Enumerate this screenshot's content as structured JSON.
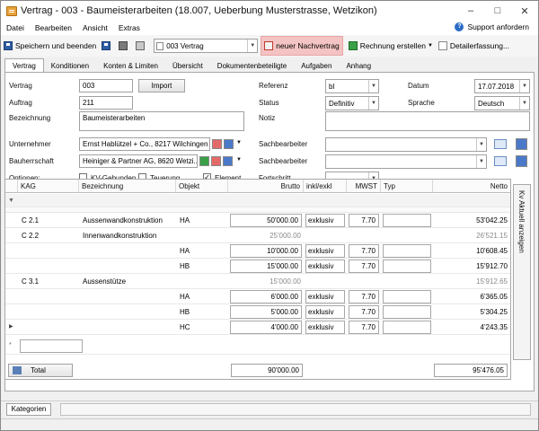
{
  "window": {
    "title": "Vertrag - 003 - Baumeisterarbeiten (18.007, Ueberbung Musterstrasse, Wetzikon)"
  },
  "menu": [
    "Datei",
    "Bearbeiten",
    "Ansicht",
    "Extras"
  ],
  "support": "Support anfordern",
  "toolbar": {
    "save_close": "Speichern und beenden",
    "vertrag_select": "003 Vertrag",
    "nachtrag": "neuer Nachvertrag",
    "rechnung": "Rechnung erstellen",
    "detail": "Detailerfassung..."
  },
  "tabs": [
    "Vertrag",
    "Konditionen",
    "Konten & Limiten",
    "Übersicht",
    "Dokumentenbeteiligte",
    "Aufgaben",
    "Anhang"
  ],
  "form": {
    "vertrag_label": "Vertrag",
    "vertrag_value": "003",
    "import_btn": "Import",
    "auftrag_label": "Auftrag",
    "auftrag_value": "211",
    "bezeichnung_label": "Bezeichnung",
    "bezeichnung_value": "Baumeisterarbeiten",
    "referenz_label": "Referenz",
    "referenz_value": "bl",
    "status_label": "Status",
    "status_value": "Definitiv",
    "notiz_label": "Notiz",
    "datum_label": "Datum",
    "datum_value": "17.07.2018",
    "sprache_label": "Sprache",
    "sprache_value": "Deutsch",
    "unternehmer_label": "Unternehmer",
    "unternehmer_value": "Ernst Hablützel + Co., 8217 Wilchingen",
    "bauherr_label": "Bauherrschaft",
    "bauherr_value": "Heiniger & Partner AG, 8620 Wetzi...",
    "sachb1_label": "Sachbearbeiter",
    "sachb2_label": "Sachbearbeiter",
    "optionen_label": "Optionen:",
    "opt_kv": "KV-Gebunden",
    "opt_teuerung": "Teuerung",
    "opt_element": "Element",
    "fortschritt_label": "Fortschritt"
  },
  "grid": {
    "headers": [
      "KAG",
      "Bezeichnung",
      "Objekt",
      "Brutto",
      "inkl/exkl",
      "MWST %",
      "Typ",
      "Netto"
    ],
    "rows": [
      {
        "kag": "C 2.1",
        "bez": "Aussenwandkonstruktion",
        "obj": "HA",
        "brutto": "50'000.00",
        "ie": "exklusiv",
        "mwst": "7.70",
        "netto": "53'042.25",
        "sub": false
      },
      {
        "kag": "C 2.2",
        "bez": "Innenwandkonstruktion",
        "obj": "",
        "brutto": "25'000.00",
        "ie": "",
        "mwst": "",
        "netto": "26'521.15",
        "sub": true
      },
      {
        "kag": "",
        "bez": "",
        "obj": "HA",
        "brutto": "10'000.00",
        "ie": "exklusiv",
        "mwst": "7.70",
        "netto": "10'608.45",
        "sub": false
      },
      {
        "kag": "",
        "bez": "",
        "obj": "HB",
        "brutto": "15'000.00",
        "ie": "exklusiv",
        "mwst": "7.70",
        "netto": "15'912.70",
        "sub": false
      },
      {
        "kag": "C 3.1",
        "bez": "Aussenstütze",
        "obj": "",
        "brutto": "15'000.00",
        "ie": "",
        "mwst": "",
        "netto": "15'912.65",
        "sub": true
      },
      {
        "kag": "",
        "bez": "",
        "obj": "HA",
        "brutto": "6'000.00",
        "ie": "exklusiv",
        "mwst": "7.70",
        "netto": "6'365.05",
        "sub": false
      },
      {
        "kag": "",
        "bez": "",
        "obj": "HB",
        "brutto": "5'000.00",
        "ie": "exklusiv",
        "mwst": "7.70",
        "netto": "5'304.25",
        "sub": false
      },
      {
        "kag": "",
        "bez": "",
        "obj": "HC",
        "brutto": "4'000.00",
        "ie": "exklusiv",
        "mwst": "7.70",
        "netto": "4'243.35",
        "sub": false
      }
    ],
    "total_label": "Total",
    "total_brutto": "90'000.00",
    "total_netto": "95'476.05"
  },
  "side_tab": "Kv Aktuell anzeigen",
  "status": {
    "kategorien": "Kategorien"
  }
}
